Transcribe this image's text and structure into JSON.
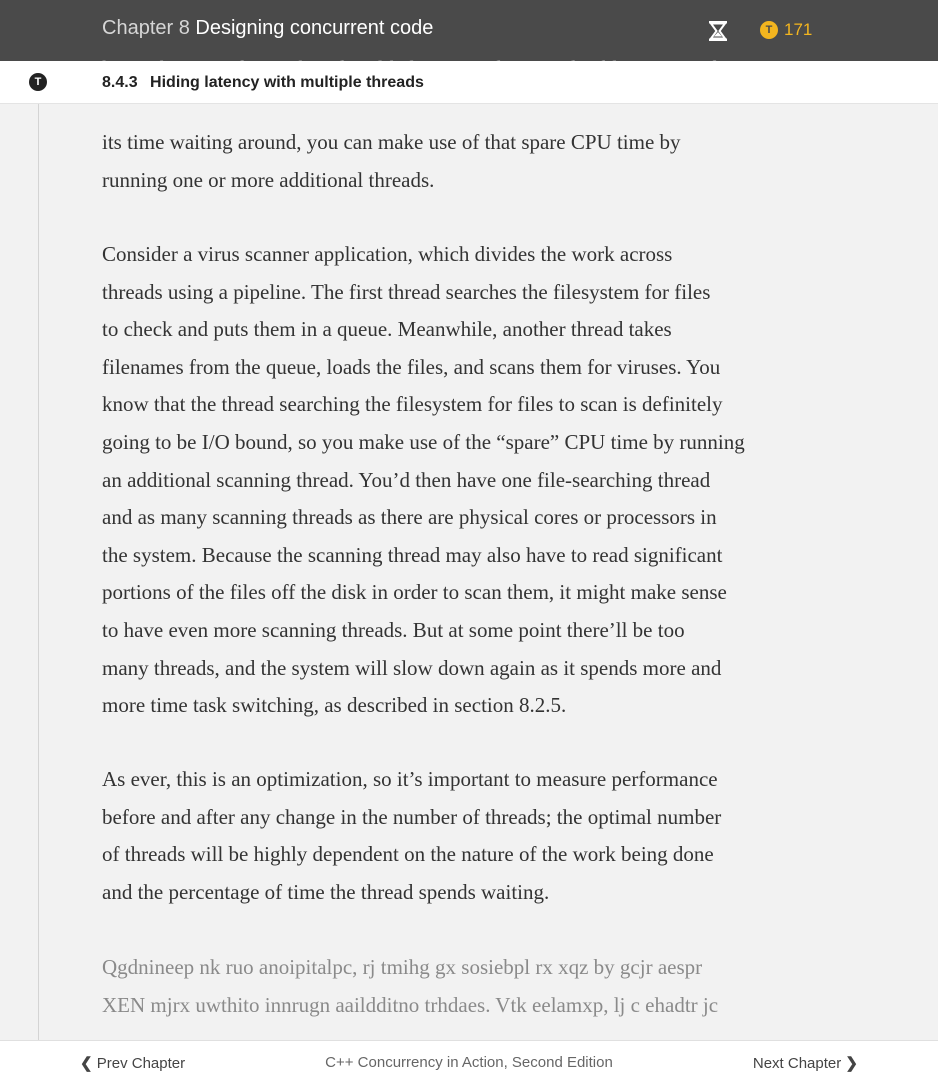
{
  "header": {
    "chapter_number": "Chapter 8",
    "chapter_title": "Designing concurrent code",
    "token_count": "171",
    "icons": [
      "hourglass-icon",
      "token-icon"
    ],
    "colors": {
      "bar": "#4a4a4a",
      "token": "#f3b51f"
    }
  },
  "section": {
    "number": "8.4.3",
    "title": "Hiding latency with multiple threads",
    "icon": "section-icon"
  },
  "content": {
    "partial_line": "know that one of your threads is likely to spend a considerable portion of",
    "paragraphs": [
      "its time waiting around, you can make use of that spare CPU time by\nrunning one or more additional threads.",
      "Consider a virus scanner application, which divides the work across\nthreads using a pipeline. The first thread searches the filesystem for files\nto check and puts them in a queue. Meanwhile, another thread takes\nfilenames from the queue, loads the files, and scans them for viruses. You\nknow that the thread searching the filesystem for files to scan is definitely\ngoing to be I/O bound, so you make use of the “spare” CPU time by running\nan additional scanning thread. You’d then have one file-searching thread\nand as many scanning threads as there are physical cores or processors in\nthe system. Because the scanning thread may also have to read significant\nportions of  the files off the disk in order to scan them, it might make sense\nto have even more scanning threads. But at some point there’ll be too\nmany threads, and the system will slow down again as it spends more and\nmore time task switching, as described in section 8.2.5.",
      "As ever, this is an optimization, so it’s important to measure performance\nbefore and after any change in the number of threads; the optimal number\nof threads will be highly dependent on the nature of the work being done\nand the percentage of time the thread spends waiting.",
      "Qgdnineep nk ruo anoipitalpc, rj tmihg gx sosiebpl rx xqz by gcjr aespr\nXEN mjrx uwthito innrugn aaildditno trhdaes. Vtk eelamxp, lj c ehadtr jc"
    ]
  },
  "footer": {
    "prev_label": "Prev Chapter",
    "book_title": "C++ Concurrency in Action, Second Edition",
    "next_label": "Next Chapter"
  }
}
